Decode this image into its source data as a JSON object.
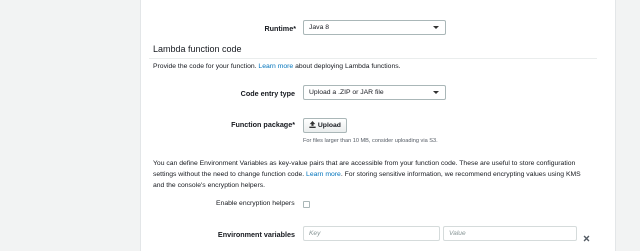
{
  "runtime": {
    "label": "Runtime*",
    "value": "Java 8"
  },
  "function_code": {
    "heading": "Lambda function code",
    "desc_prefix": "Provide the code for your function.",
    "desc_link": "Learn more",
    "desc_suffix": "about deploying Lambda functions."
  },
  "code_entry": {
    "label": "Code entry type",
    "value": "Upload a .ZIP or JAR file"
  },
  "package": {
    "label": "Function package*",
    "button_label": "Upload",
    "hint": "For files larger than 10 MB, consider uploading via S3."
  },
  "env_info": {
    "line1": "You can define Environment Variables as key-value pairs that are accessible from your function code. These are useful to store configuration",
    "line2_prefix": "settings without the need to change function code.",
    "line2_link": "Learn more",
    "line2_suffix": ". For storing sensitive information, we recommend encrypting values using KMS",
    "line3": "and the console's encryption helpers."
  },
  "encryption": {
    "label": "Enable encryption helpers",
    "checked": false
  },
  "env_vars": {
    "label": "Environment variables",
    "key_placeholder": "Key",
    "value_placeholder": "Value",
    "remove_icon": "close-icon"
  }
}
